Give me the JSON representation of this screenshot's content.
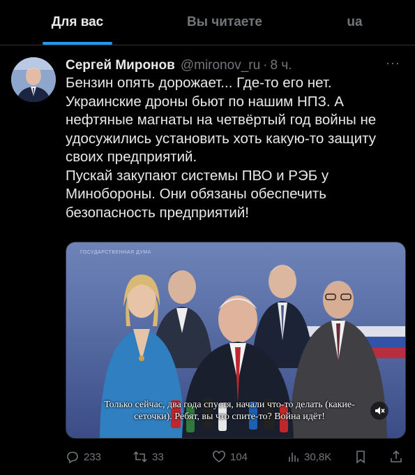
{
  "tabs": [
    {
      "label": "Для вас"
    },
    {
      "label": "Вы читаете"
    },
    {
      "label": "ua"
    }
  ],
  "post": {
    "author_name": "Сергей Миронов",
    "handle": "@mironov_ru",
    "separator": "·",
    "time": "8 ч.",
    "more": "···",
    "lines": [
      "Бензин опять дорожает... Где-то его нет.",
      "Украинские дроны бьют по нашим НПЗ. А нефтяные магнаты на четвёртый год войны не удосужились установить хоть какую-то защиту своих предприятий.",
      "Пускай закупают системы ПВО и РЭБ у Минобороны. Они обязаны обеспечить безопасность предприятий!"
    ],
    "video": {
      "subtitle_line1": "Только сейчас, два года спустя, начали что-то делать (какие-",
      "subtitle_line2": "сеточки). Ребят, вы что спите-то? Война идёт!",
      "background_text": "ГОСУДАРСТВЕННАЯ ДУМА",
      "mute_icon": "speaker-muted-icon"
    },
    "metrics": {
      "replies": "233",
      "reposts": "33",
      "likes": "104",
      "views": "30,8K"
    }
  },
  "colors": {
    "background": "#000000",
    "text": "#e7e9ea",
    "muted": "#71767b",
    "accent": "#1d9bf0"
  }
}
